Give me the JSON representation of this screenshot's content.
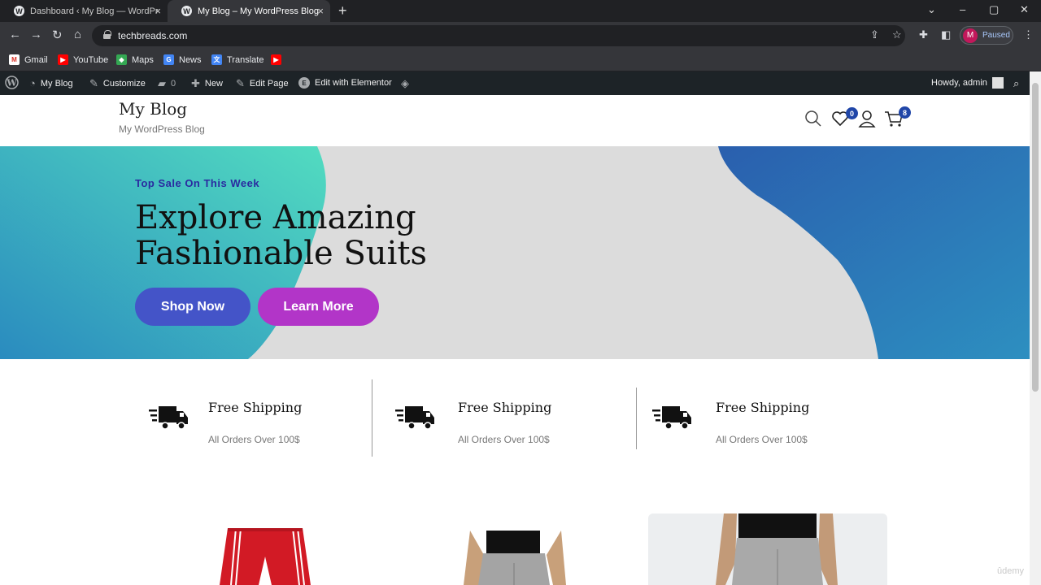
{
  "browser": {
    "tabs": [
      {
        "title": "Dashboard ‹ My Blog — WordPr",
        "active": false
      },
      {
        "title": "My Blog – My WordPress Blog",
        "active": true
      }
    ],
    "url": "techbreads.com",
    "profile_initial": "M",
    "profile_status": "Paused"
  },
  "bookmarks": [
    {
      "label": "Gmail",
      "icon": "gmail-icon"
    },
    {
      "label": "YouTube",
      "icon": "youtube-icon"
    },
    {
      "label": "Maps",
      "icon": "maps-icon"
    },
    {
      "label": "News",
      "icon": "news-icon"
    },
    {
      "label": "Translate",
      "icon": "translate-icon"
    }
  ],
  "wp_admin_bar": {
    "site": "My Blog",
    "customize": "Customize",
    "comments_count": "0",
    "new": "New",
    "edit_page": "Edit Page",
    "edit_elementor": "Edit with Elementor",
    "howdy": "Howdy, admin"
  },
  "site": {
    "title": "My Blog",
    "tagline": "My WordPress Blog",
    "wishlist_count": "0",
    "cart_count": "8"
  },
  "hero": {
    "kicker": "Top Sale On This Week",
    "title": "Explore Amazing Fashionable Suits",
    "shop_button": "Shop Now",
    "learn_button": "Learn More",
    "colors": {
      "teal": "#4fd8c0",
      "blue": "#2a6fb0",
      "background": "#dcdcdc",
      "shop": "#4454c8",
      "learn": "#b235c8"
    }
  },
  "features": [
    {
      "title": "Free Shipping",
      "subtitle": "All Orders Over 100$"
    },
    {
      "title": "Free Shipping",
      "subtitle": "All Orders Over 100$"
    },
    {
      "title": "Free Shipping",
      "subtitle": "All Orders Over 100$"
    }
  ],
  "watermark": "ûdemy"
}
